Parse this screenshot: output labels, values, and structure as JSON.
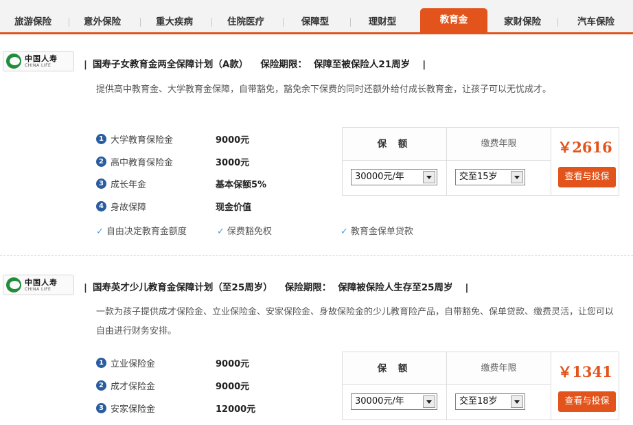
{
  "tabs": [
    {
      "label": "旅游保险",
      "active": false
    },
    {
      "label": "意外保险",
      "active": false
    },
    {
      "label": "重大疾病",
      "active": false
    },
    {
      "label": "住院医疗",
      "active": false
    },
    {
      "label": "保障型",
      "active": false
    },
    {
      "label": "理财型",
      "active": false
    },
    {
      "label": "教育金",
      "active": true
    },
    {
      "label": "家财保险",
      "active": false
    },
    {
      "label": "汽车保险",
      "active": false
    }
  ],
  "colors": {
    "accent": "#e2541b",
    "number_badge": "#2a5d9f",
    "check": "#4a96d8",
    "logo_green": "#1f8d3a"
  },
  "logo": {
    "cn": "中国人寿",
    "en": "CHINA LIFE"
  },
  "products": [
    {
      "title": "国寿子女教育金两全保障计划（A款）",
      "term_label": "保险期限：",
      "term_value": "保障至被保险人21周岁",
      "description": "提供高中教育金、大学教育金保障，自带豁免，豁免余下保费的同时还额外给付成长教育金，让孩子可以无忧成才。",
      "features": [
        {
          "num": "1",
          "name": "大学教育保险金",
          "value": "9000元"
        },
        {
          "num": "2",
          "name": "高中教育保险金",
          "value": "3000元"
        },
        {
          "num": "3",
          "name": "成长年金",
          "value": "基本保额5%"
        },
        {
          "num": "4",
          "name": "身故保障",
          "value": "现金价值"
        }
      ],
      "checks": [
        "自由决定教育金额度",
        "保费豁免权",
        "教育金保单贷款"
      ],
      "coverage_header": "保 额",
      "period_header": "缴费年限",
      "coverage_value": "30000元/年",
      "period_value": "交至15岁",
      "price": "￥2616",
      "buy_label": "查看与投保"
    },
    {
      "title": "国寿英才少儿教育金保障计划（至25周岁）",
      "term_label": "保险期限：",
      "term_value": "保障被保险人生存至25周岁",
      "description": "一款为孩子提供成才保险金、立业保险金、安家保险金、身故保险金的少儿教育险产品，自带豁免、保单贷款、缴费灵活，让您可以自由进行财务安排。",
      "features": [
        {
          "num": "1",
          "name": "立业保险金",
          "value": "9000元"
        },
        {
          "num": "2",
          "name": "成才保险金",
          "value": "9000元"
        },
        {
          "num": "3",
          "name": "安家保险金",
          "value": "12000元"
        }
      ],
      "coverage_header": "保 额",
      "period_header": "缴费年限",
      "coverage_value": "30000元/年",
      "period_value": "交至18岁",
      "price": "￥1341",
      "buy_label": "查看与投保"
    }
  ]
}
